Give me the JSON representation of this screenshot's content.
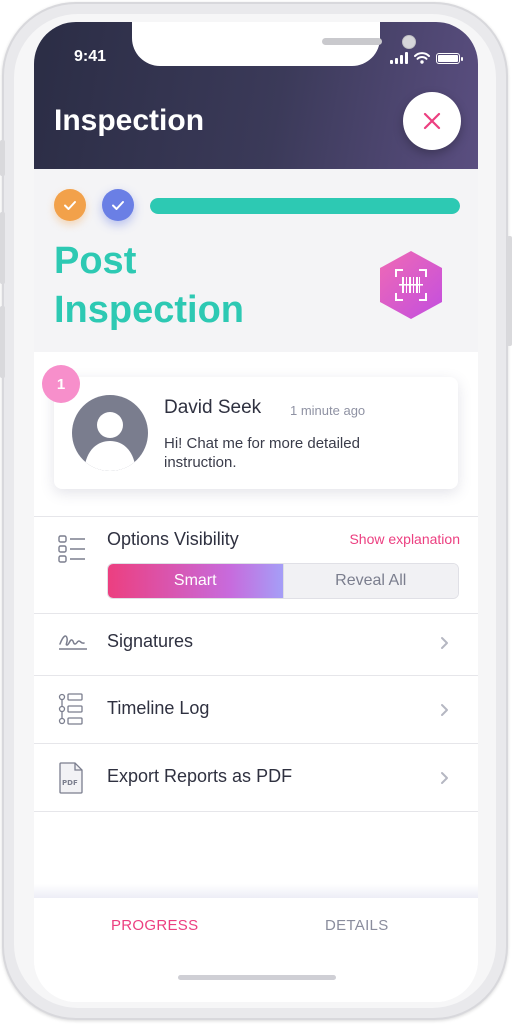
{
  "status_bar": {
    "time": "9:41"
  },
  "header": {
    "title": "Inspection"
  },
  "progress": {
    "percent": 100,
    "stage_title": "Post Inspection"
  },
  "chat": {
    "badge_count": "1",
    "name": "David Seek",
    "time": "1 minute ago",
    "message": "Hi! Chat me for more detailed instruction."
  },
  "options": {
    "visibility_label": "Options Visibility",
    "show_explanation": "Show explanation",
    "smart_label": "Smart",
    "reveal_all_label": "Reveal All"
  },
  "menu": {
    "signatures": "Signatures",
    "timeline_log": "Timeline Log",
    "export_pdf": "Export Reports as PDF",
    "pdf_icon_text": "PDF"
  },
  "tabs": {
    "progress": "PROGRESS",
    "details": "DETAILS"
  },
  "colors": {
    "accent_pink": "#ec3f80",
    "accent_teal": "#2dc9b3",
    "header_dark": "#2b2d45",
    "step_orange": "#f2a14a",
    "step_blue": "#6a7fe5"
  },
  "icons": {
    "close": "close-icon",
    "check": "check-icon",
    "barcode": "barcode-scan-icon",
    "options": "list-options-icon",
    "signature": "signature-icon",
    "timeline": "timeline-icon",
    "pdf": "pdf-file-icon",
    "chevron": "chevron-right-icon"
  }
}
